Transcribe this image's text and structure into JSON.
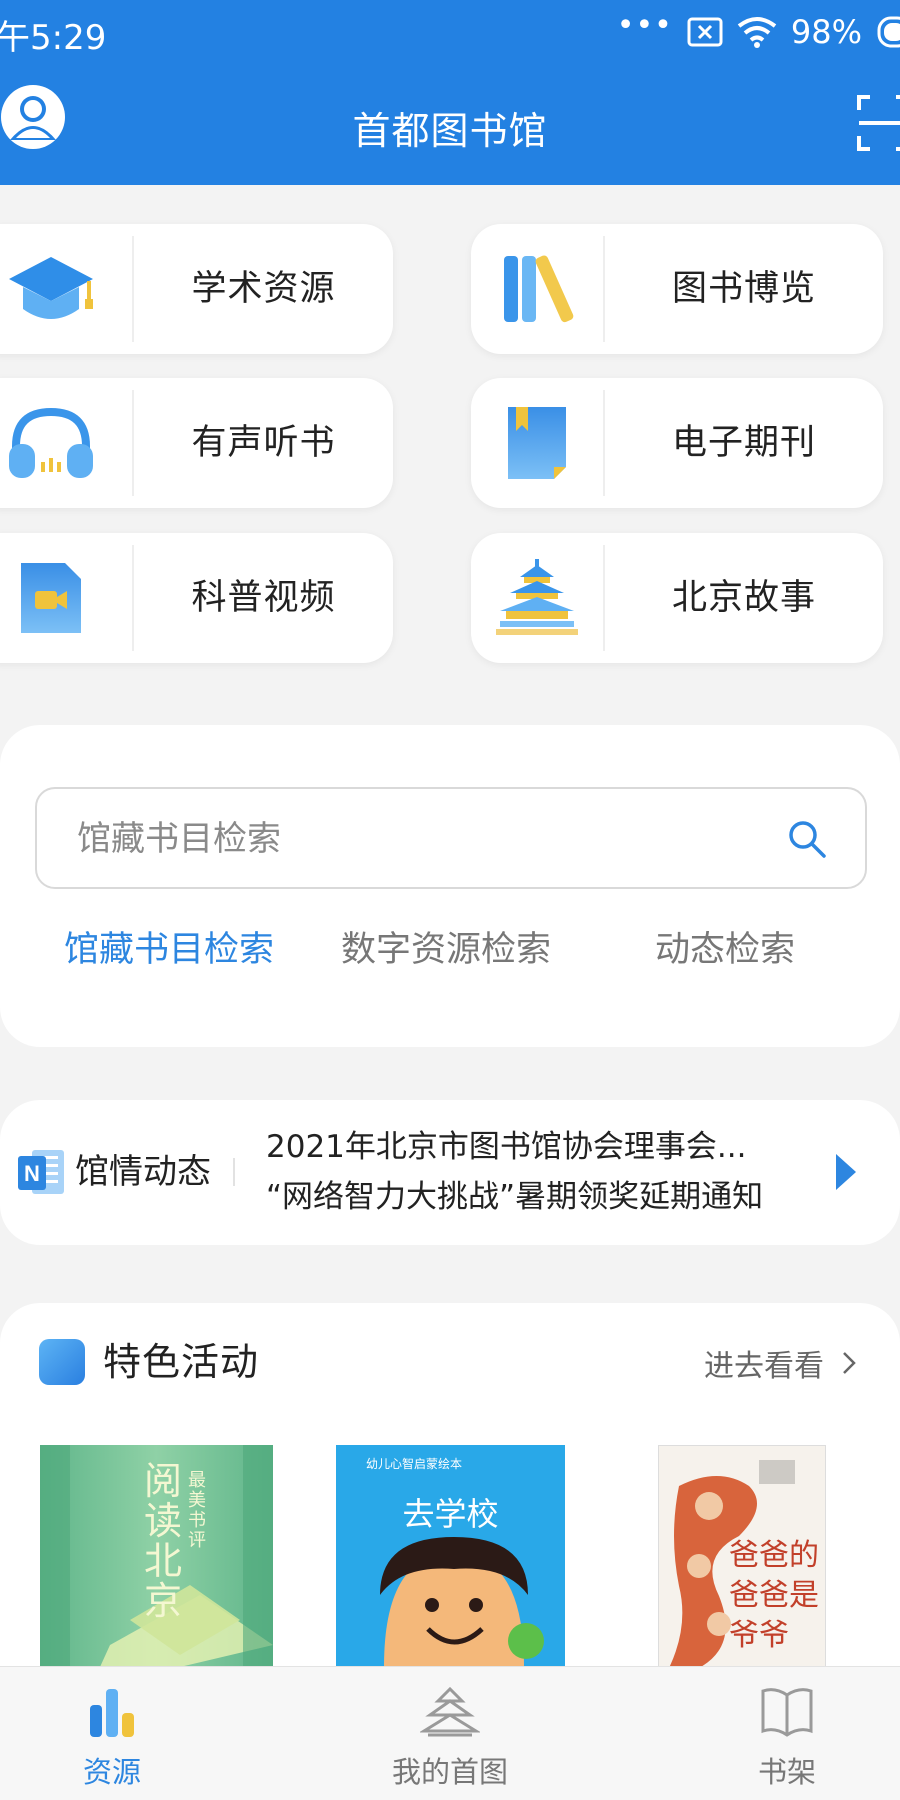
{
  "status_bar": {
    "time": "午5:29",
    "battery": "98%"
  },
  "header": {
    "title": "首都图书馆"
  },
  "entries": [
    {
      "label": "学术资源",
      "icon": "graduation-cap-icon"
    },
    {
      "label": "图书博览",
      "icon": "books-icon"
    },
    {
      "label": "有声听书",
      "icon": "headphones-icon"
    },
    {
      "label": "电子期刊",
      "icon": "journal-icon"
    },
    {
      "label": "科普视频",
      "icon": "video-file-icon"
    },
    {
      "label": "北京故事",
      "icon": "temple-of-heaven-icon"
    }
  ],
  "search": {
    "placeholder": "馆藏书目检索",
    "tabs": [
      "馆藏书目检索",
      "数字资源检索",
      "动态检索"
    ],
    "active_tab": 0
  },
  "news": {
    "title": "馆情动态",
    "items": [
      "2021年北京市图书馆协会理事会...",
      "“网络智力大挑战”暑期领奖延期通知"
    ]
  },
  "featured": {
    "title": "特色活动",
    "more_label": "进去看看",
    "books": [
      {
        "title": "阅读北京",
        "subtitle": "最美书评"
      },
      {
        "title": "去学校",
        "subtitle": "幼儿心智启蒙绘本"
      },
      {
        "title": "爸爸的爸爸是爷爷",
        "subtitle": ""
      }
    ]
  },
  "nav": {
    "items": [
      {
        "label": "资源",
        "icon": "resources-chart-icon"
      },
      {
        "label": "我的首图",
        "icon": "temple-icon"
      },
      {
        "label": "书架",
        "icon": "open-book-icon"
      }
    ],
    "active": 0
  },
  "colors": {
    "primary": "#2381e2",
    "accent_text": "#2d86e0",
    "background": "#f3f3f3"
  }
}
